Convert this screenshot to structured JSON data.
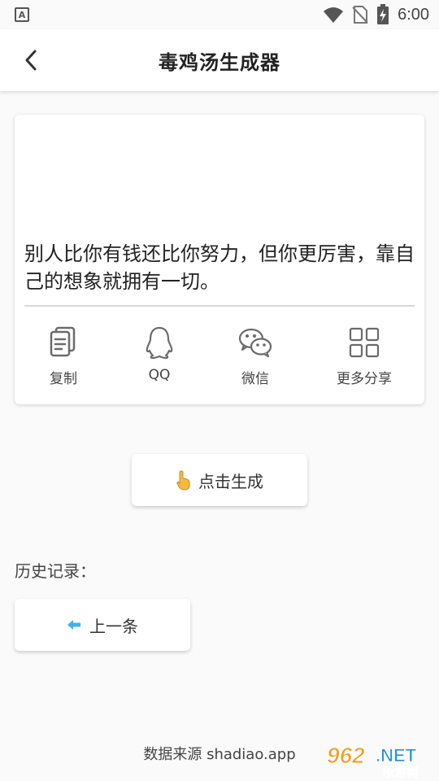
{
  "status_bar": {
    "left_icon_letter": "A",
    "time": "6:00",
    "icons": [
      "wifi-icon",
      "no-sim-icon",
      "battery-charging-icon"
    ]
  },
  "app_bar": {
    "title": "毒鸡汤生成器",
    "back_icon": "chevron-left-icon"
  },
  "quote": {
    "text": "别人比你有钱还比你努力，但你更厉害，靠自己的想象就拥有一切。"
  },
  "share": {
    "items": [
      {
        "label": "复制",
        "icon": "copy-icon"
      },
      {
        "label": "QQ",
        "icon": "qq-penguin-icon"
      },
      {
        "label": "微信",
        "icon": "wechat-icon"
      },
      {
        "label": "更多分享",
        "icon": "grid-icon"
      }
    ]
  },
  "generate": {
    "label": "点击生成",
    "icon": "pointing-hand-icon"
  },
  "history": {
    "label": "历史记录：",
    "prev_label": "上一条",
    "prev_icon": "arrow-left-icon"
  },
  "footer": {
    "source": "数据来源 shadiao.app",
    "watermark": {
      "number": "962",
      "suffix": ".NET",
      "sub": "乐游网"
    }
  },
  "colors": {
    "accent_arrow": "#3db5e6",
    "hand": "#f5b942",
    "watermark_blue": "#2b90d9",
    "watermark_orange": "#f39c1f"
  }
}
